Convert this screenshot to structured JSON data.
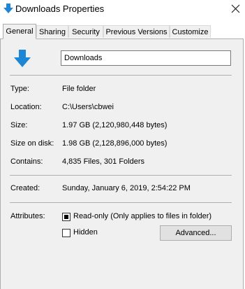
{
  "window": {
    "title": "Downloads Properties",
    "icon": "download-arrow-icon",
    "close_icon": "close-icon"
  },
  "tabs": [
    {
      "label": "General",
      "active": true
    },
    {
      "label": "Sharing",
      "active": false
    },
    {
      "label": "Security",
      "active": false
    },
    {
      "label": "Previous Versions",
      "active": false
    },
    {
      "label": "Customize",
      "active": false
    }
  ],
  "general": {
    "folder_name": "Downloads",
    "folder_icon": "download-arrow-icon",
    "type_label": "Type:",
    "type_value": "File folder",
    "location_label": "Location:",
    "location_value": "C:\\Users\\cbwei",
    "size_label": "Size:",
    "size_value": "1.97 GB (2,120,980,448 bytes)",
    "size_on_disk_label": "Size on disk:",
    "size_on_disk_value": "1.98 GB (2,128,896,000 bytes)",
    "contains_label": "Contains:",
    "contains_value": "4,835 Files, 301 Folders",
    "created_label": "Created:",
    "created_value": "Sunday, January 6, 2019, 2:54:22 PM",
    "attributes_label": "Attributes:",
    "readonly_label": "Read-only (Only applies to files in folder)",
    "readonly_state": "indeterminate",
    "hidden_label": "Hidden",
    "hidden_checked": false,
    "advanced_button": "Advanced..."
  },
  "colors": {
    "accent_blue": "#1e86d6",
    "panel_bg": "#f0f0f0"
  }
}
